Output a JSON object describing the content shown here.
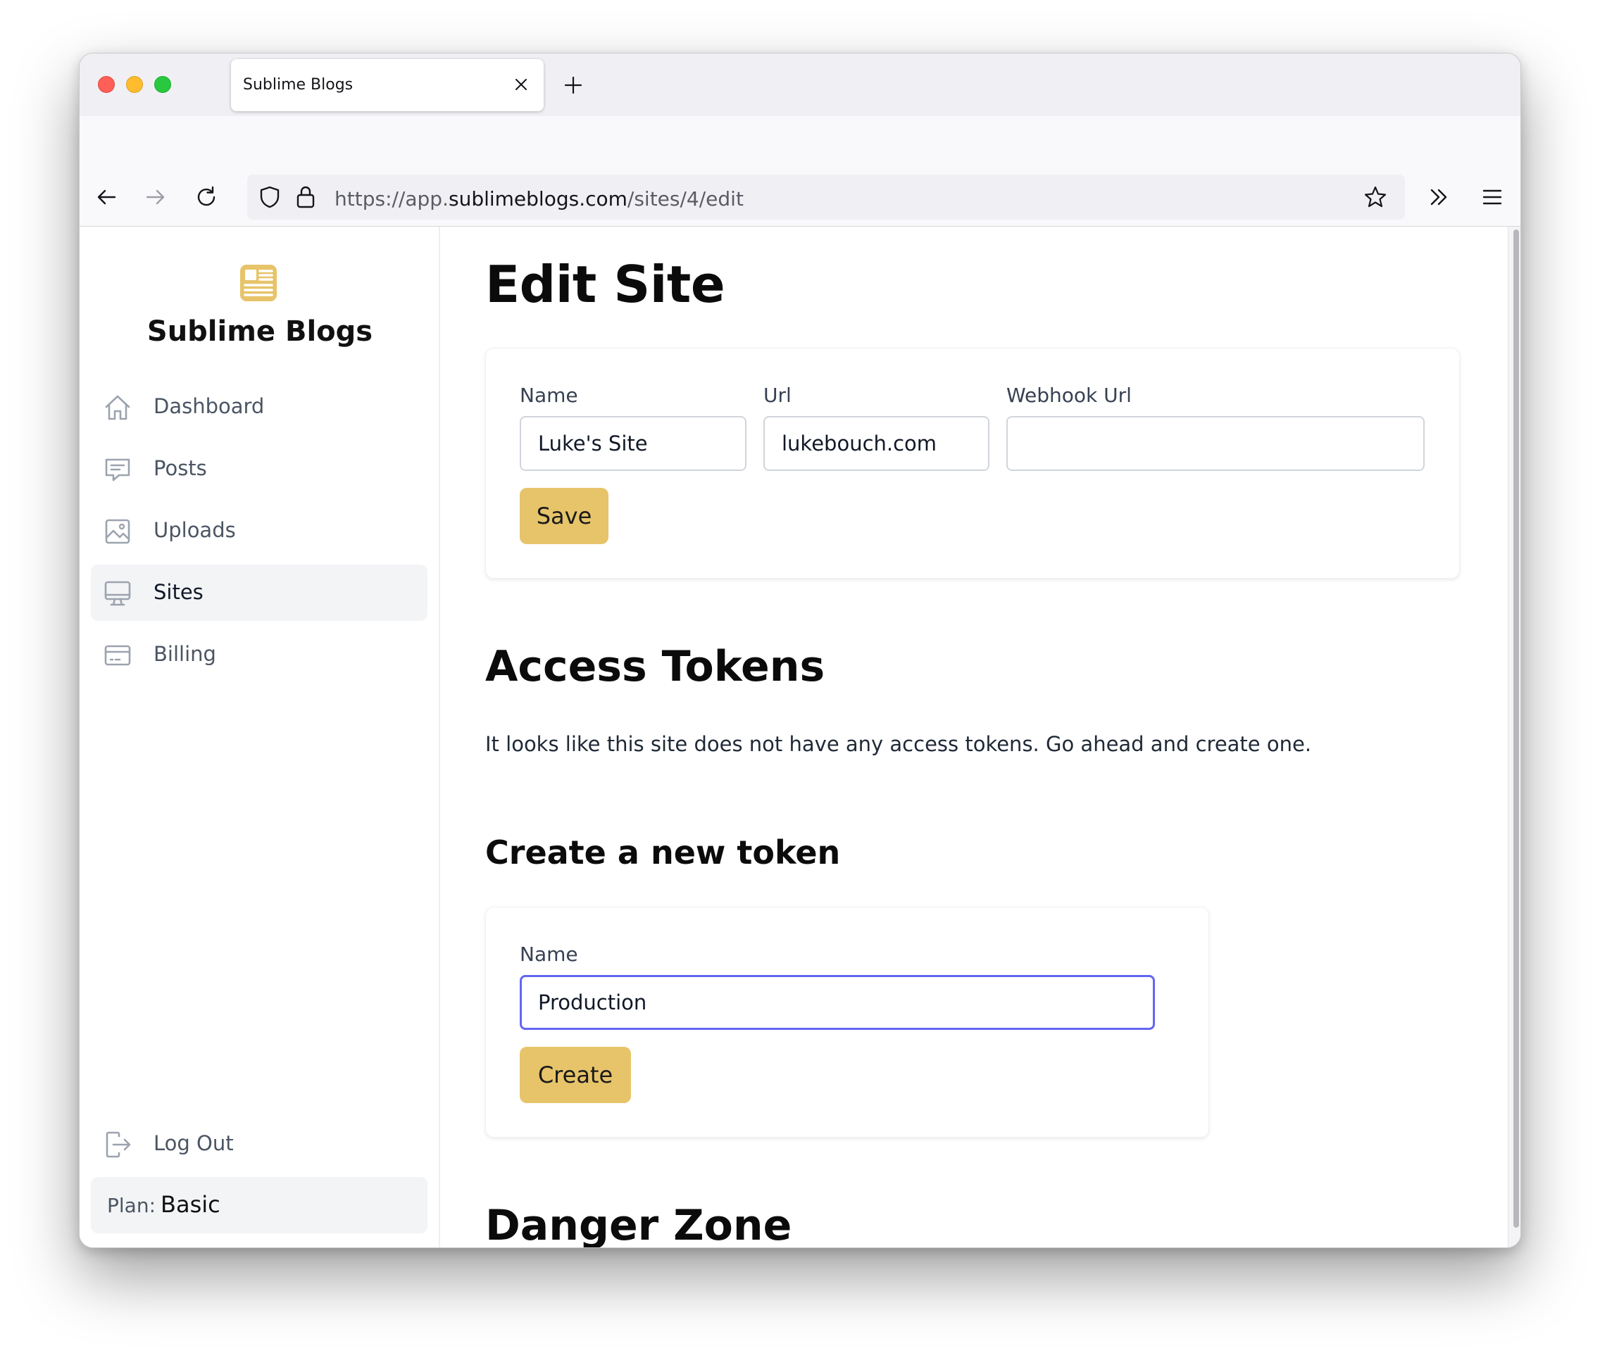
{
  "browser": {
    "tab_title": "Sublime Blogs",
    "url_prefix": "https://app.",
    "url_domain": "sublimeblogs.com",
    "url_path": "/sites/4/edit"
  },
  "sidebar": {
    "brand": "Sublime Blogs",
    "items": [
      {
        "label": "Dashboard",
        "icon": "home-icon"
      },
      {
        "label": "Posts",
        "icon": "chat-icon"
      },
      {
        "label": "Uploads",
        "icon": "image-icon"
      },
      {
        "label": "Sites",
        "icon": "desktop-icon",
        "active": true
      },
      {
        "label": "Billing",
        "icon": "credit-card-icon"
      }
    ],
    "logout_label": "Log Out",
    "plan_label": "Plan:",
    "plan_value": "Basic"
  },
  "edit_site": {
    "title": "Edit Site",
    "name_label": "Name",
    "name_value": "Luke's Site",
    "url_label": "Url",
    "url_value": "lukebouch.com",
    "webhook_label": "Webhook Url",
    "webhook_value": "",
    "save_label": "Save"
  },
  "access_tokens": {
    "title": "Access Tokens",
    "empty_message": "It looks like this site does not have any access tokens. Go ahead and create one."
  },
  "create_token": {
    "title": "Create a new token",
    "name_label": "Name",
    "name_value": "Production",
    "create_label": "Create"
  },
  "danger_zone": {
    "title": "Danger Zone"
  },
  "colors": {
    "accent": "#e7c46a",
    "focus": "#6366f1",
    "danger": "#dc2626"
  }
}
